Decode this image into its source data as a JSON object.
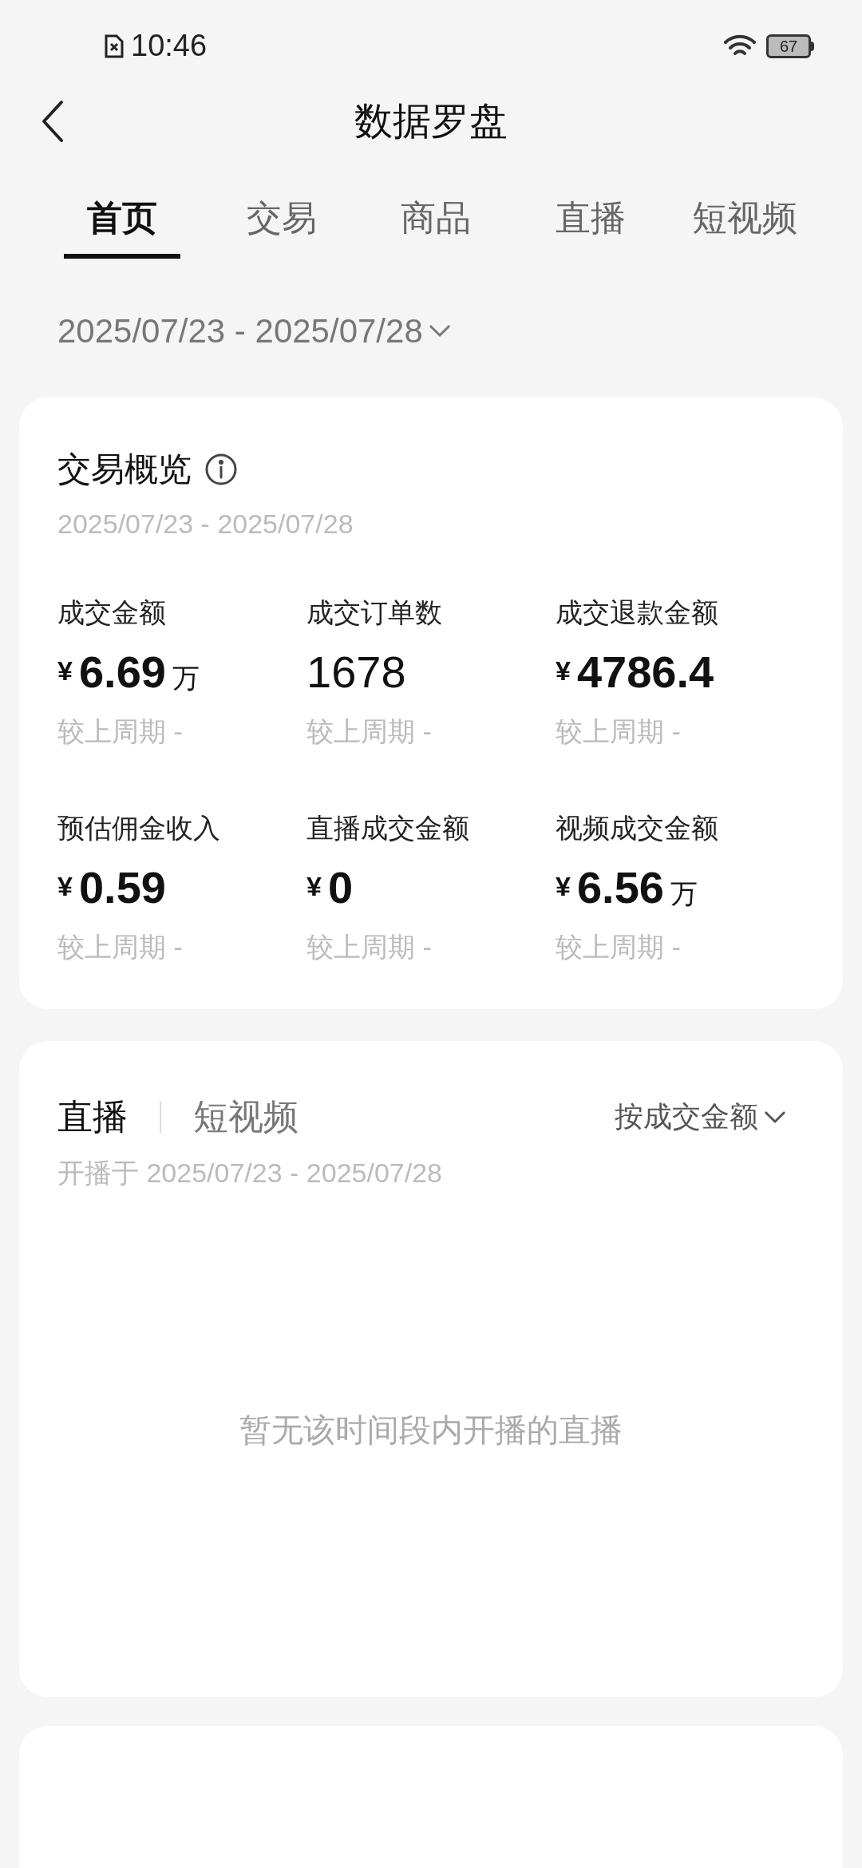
{
  "status_bar": {
    "time": "10:46",
    "battery": "67"
  },
  "header": {
    "title": "数据罗盘"
  },
  "tabs": [
    {
      "label": "首页",
      "selected": true
    },
    {
      "label": "交易",
      "selected": false
    },
    {
      "label": "商品",
      "selected": false
    },
    {
      "label": "直播",
      "selected": false
    },
    {
      "label": "短视频",
      "selected": false
    }
  ],
  "date_range": "2025/07/23 - 2025/07/28",
  "overview": {
    "title": "交易概览",
    "date": "2025/07/23 - 2025/07/28",
    "metrics": [
      {
        "label": "成交金额",
        "currency": "¥",
        "value": "6.69",
        "unit": "万",
        "compare": "较上周期 -"
      },
      {
        "label": "成交订单数",
        "value": "1678",
        "compare": "较上周期 -"
      },
      {
        "label": "成交退款金额",
        "currency": "¥",
        "value": "4786.4",
        "compare": "较上周期 -"
      },
      {
        "label": "预估佣金收入",
        "currency": "¥",
        "value": "0.59",
        "compare": "较上周期 -"
      },
      {
        "label": "直播成交金额",
        "currency": "¥",
        "value": "0",
        "compare": "较上周期 -"
      },
      {
        "label": "视频成交金额",
        "currency": "¥",
        "value": "6.56",
        "unit": "万",
        "compare": "较上周期 -"
      }
    ]
  },
  "ranking": {
    "tabs": [
      {
        "label": "直播",
        "selected": true
      },
      {
        "label": "短视频",
        "selected": false
      }
    ],
    "sort": "按成交金额",
    "subtitle": "开播于 2025/07/23 - 2025/07/28",
    "empty": "暂无该时间段内开播的直播"
  }
}
